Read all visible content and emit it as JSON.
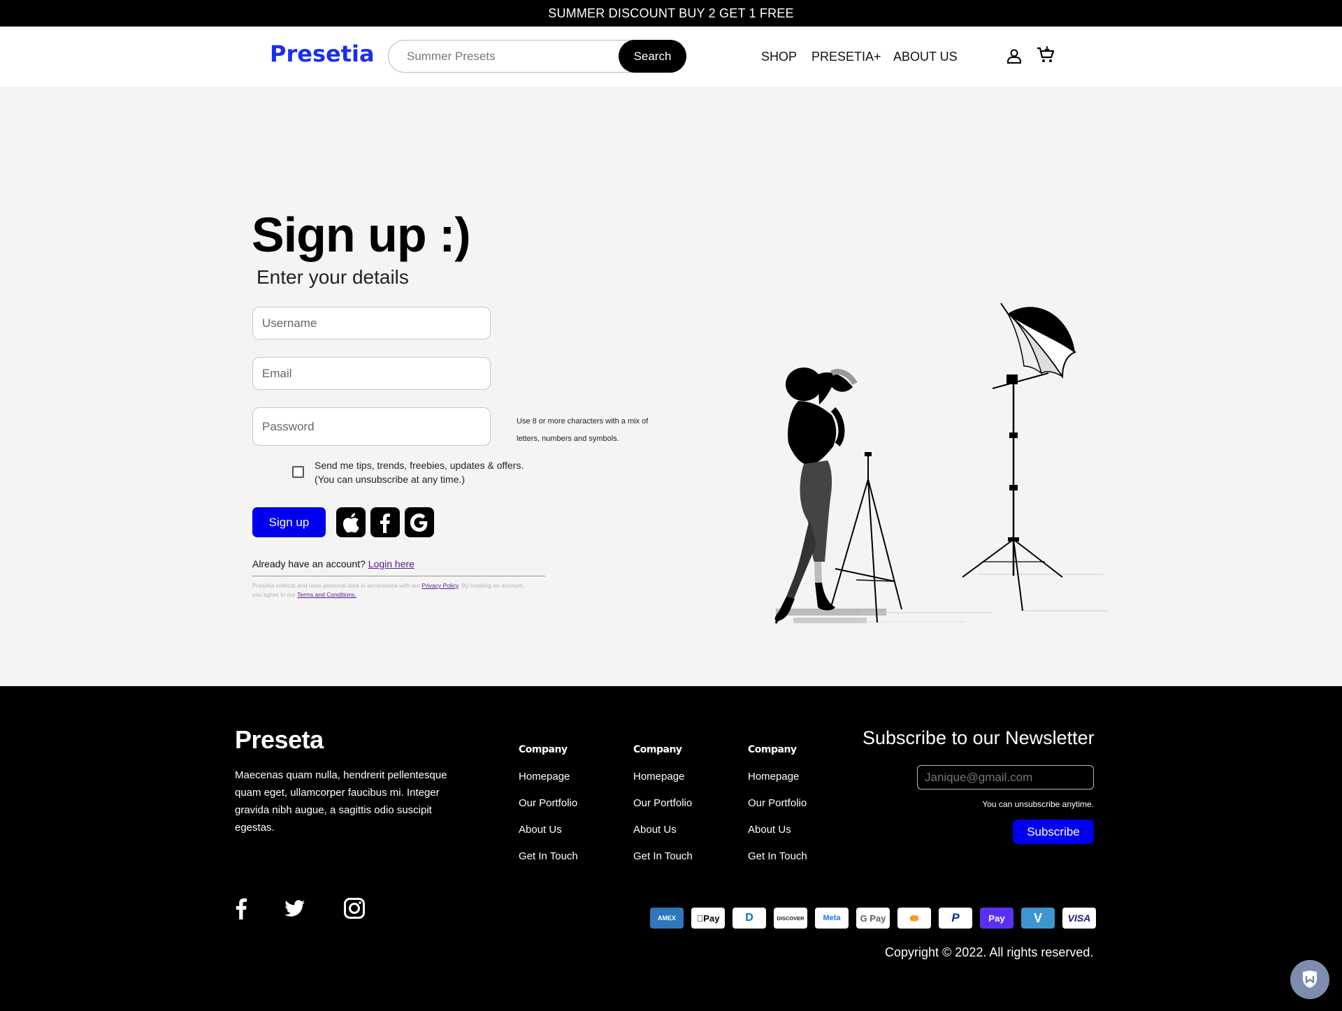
{
  "promo": {
    "text": "SUMMER DISCOUNT BUY 2 GET 1 FREE"
  },
  "header": {
    "logo": "Presetia",
    "search": {
      "placeholder": "Summer Presets",
      "button": "Search"
    },
    "nav": [
      "SHOP",
      "PRESETIA+",
      "ABOUT US"
    ],
    "icons": [
      "user-icon",
      "cart-icon"
    ]
  },
  "signup": {
    "title": "Sign up :)",
    "subtitle": "Enter your details",
    "username_placeholder": "Username",
    "email_placeholder": "Email",
    "password_placeholder": "Password",
    "password_hint": "Use 8 or more characters with a mix of letters, numbers and symbols.",
    "newsletter_checkbox": {
      "checked": false,
      "label_line1": "Send me tips, trends, freebies, updates & offers.",
      "label_line2": "(You can unsubscribe at any time.)"
    },
    "button": "Sign up",
    "social_buttons": [
      "apple-icon",
      "facebook-icon",
      "google-icon"
    ],
    "have_account": "Already have an account?",
    "login_link": "Login here",
    "legal": {
      "part1": "Presetia collects and uses personal data in accordance with our",
      "privacy_link": "Privacy Policy",
      "part2": ". By creating an account, you agree to our",
      "terms_link": "Terms and Conditions."
    }
  },
  "footer": {
    "logo": "Preseta",
    "description": "Maecenas quam nulla, hendrerit pellentesque quam eget, ullamcorper faucibus mi. Integer gravida nibh augue, a sagittis odio suscipit egestas.",
    "columns": [
      {
        "heading": "Company",
        "links": [
          "Homepage",
          "Our Portfolio",
          "About Us",
          "Get In Touch"
        ]
      },
      {
        "heading": "Company",
        "links": [
          "Homepage",
          "Our Portfolio",
          "About Us",
          "Get In Touch"
        ]
      },
      {
        "heading": "Company",
        "links": [
          "Homepage",
          "Our Portfolio",
          "About Us",
          "Get In Touch"
        ]
      }
    ],
    "newsletter": {
      "title": "Subscribe to our Newsletter",
      "placeholder": "Janique@gmail.com",
      "note": "You can unsubscribe anytime.",
      "button": "Subscribe"
    },
    "social": [
      "facebook-icon",
      "twitter-icon",
      "instagram-icon"
    ],
    "payments": [
      {
        "name": "AMEX",
        "color": "#2e77bc"
      },
      {
        "name": "Pay",
        "color": "#000000"
      },
      {
        "name": "D",
        "color": "#0079be"
      },
      {
        "name": "DISCOVER",
        "color": "#e66b1f"
      },
      {
        "name": "Meta",
        "color": "#1877f2"
      },
      {
        "name": "G Pay",
        "color": "#5f6368"
      },
      {
        "name": "●●",
        "color": "#eb001b"
      },
      {
        "name": "P",
        "color": "#003087"
      },
      {
        "name": "Pay",
        "color": "#ffffff"
      },
      {
        "name": "V",
        "color": "#ffffff"
      },
      {
        "name": "VISA",
        "color": "#1a1f71"
      }
    ],
    "copyright": "Copyright © 2022. All rights reserved."
  },
  "colors": {
    "accent": "#0000ef",
    "logo": "#1a2ff0",
    "background": "#f4f4f4"
  }
}
